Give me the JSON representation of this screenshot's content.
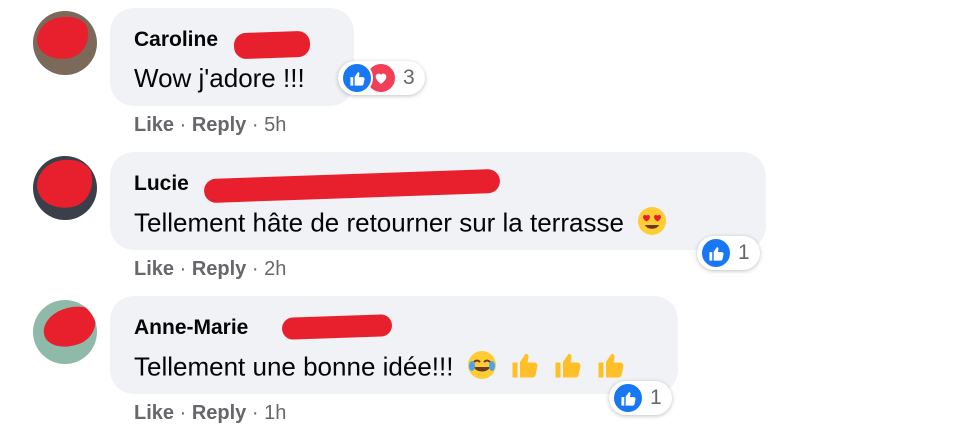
{
  "comments": [
    {
      "author": "Caroline",
      "text": "Wow j'adore !!!",
      "reaction_count": "3",
      "reactions": [
        "like-icon",
        "love-icon"
      ],
      "like_label": "Like",
      "reply_label": "Reply",
      "separator": "·",
      "time": "5h"
    },
    {
      "author": "Lucie",
      "text": "Tellement hâte de retourner sur la terrasse",
      "reaction_count": "1",
      "reactions": [
        "like-icon"
      ],
      "trailing_emoji": [
        "heart-eyes-emoji"
      ],
      "like_label": "Like",
      "reply_label": "Reply",
      "separator": "·",
      "time": "2h"
    },
    {
      "author": "Anne-Marie",
      "text": "Tellement une bonne idée!!!",
      "reaction_count": "1",
      "reactions": [
        "like-icon"
      ],
      "trailing_emoji": [
        "tears-of-joy-emoji",
        "thumbs-up-emoji",
        "thumbs-up-emoji",
        "thumbs-up-emoji"
      ],
      "like_label": "Like",
      "reply_label": "Reply",
      "separator": "·",
      "time": "1h"
    }
  ],
  "colors": {
    "bubble": "#f0f2f5",
    "like_blue": "#1877f2",
    "love_red": "#f33e58",
    "meta_gray": "#65676b",
    "redaction": "#e8202d"
  }
}
